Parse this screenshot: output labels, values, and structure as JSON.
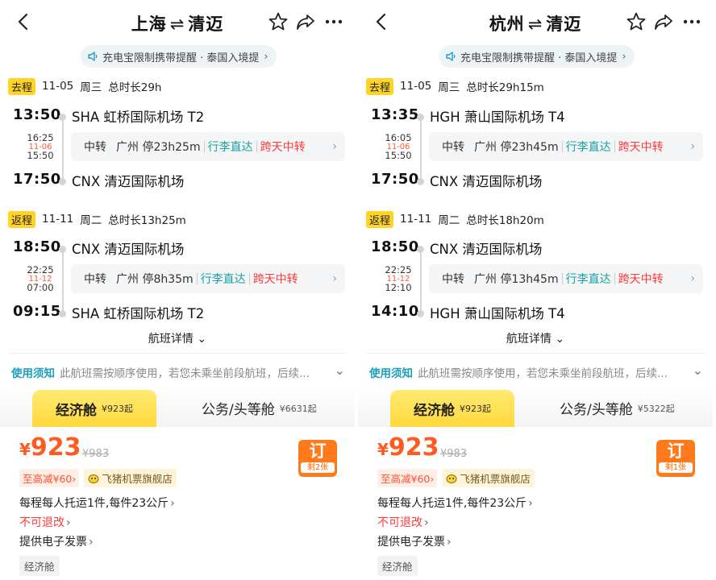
{
  "panels": [
    {
      "title_from": "上海",
      "title_arrow": "⇌",
      "title_to": "清迈",
      "notice": "充电宝限制携带提醒 · 泰国入境提",
      "outbound": {
        "badge": "去程",
        "date": "11-05",
        "weekday": "周三",
        "duration": "总时长29h",
        "dep_time": "13:50",
        "dep_airport": "SHA 虹桥国际机场 T2",
        "stop_arr": "16:25",
        "stop_date": "11-06",
        "stop_dep": "15:50",
        "transfer_label": "中转",
        "transfer_info": "广州 停23h25m",
        "luggage": "行李直达",
        "overday": "跨天中转",
        "arr_time": "17:50",
        "arr_airport": "CNX 清迈国际机场"
      },
      "return": {
        "badge": "返程",
        "date": "11-11",
        "weekday": "周二",
        "duration": "总时长13h25m",
        "dep_time": "18:50",
        "dep_airport": "CNX 清迈国际机场",
        "stop_arr": "22:25",
        "stop_date": "11-12",
        "stop_dep": "07:00",
        "transfer_label": "中转",
        "transfer_info": "广州 停8h35m",
        "luggage": "行李直达",
        "overday": "跨天中转",
        "arr_time": "09:15",
        "arr_airport": "SHA 虹桥国际机场 T2"
      },
      "details_link": "航班详情",
      "rules_label": "使用须知",
      "rules_text": "此航班需按顺序使用，若您未乘坐前段航班，后续...",
      "cabin_active": "经济舱",
      "cabin_active_price": "¥923起",
      "cabin_other": "公务/头等舱",
      "cabin_other_price": "¥6631起",
      "price_symbol": "¥",
      "price": "923",
      "orig_price": "¥983",
      "book_label": "订",
      "remaining": "剩2张",
      "discount": "至高减¥60",
      "shop": "飞猪机票旗舰店",
      "baggage": "每程每人托运1件,每件23公斤",
      "refund": "不可退改",
      "invoice": "提供电子发票",
      "cabin_tag": "经济舱"
    },
    {
      "title_from": "杭州",
      "title_arrow": "⇌",
      "title_to": "清迈",
      "notice": "充电宝限制携带提醒 · 泰国入境提",
      "outbound": {
        "badge": "去程",
        "date": "11-05",
        "weekday": "周三",
        "duration": "总时长29h15m",
        "dep_time": "13:35",
        "dep_airport": "HGH 萧山国际机场 T4",
        "stop_arr": "16:05",
        "stop_date": "11-06",
        "stop_dep": "15:50",
        "transfer_label": "中转",
        "transfer_info": "广州 停23h45m",
        "luggage": "行李直达",
        "overday": "跨天中转",
        "arr_time": "17:50",
        "arr_airport": "CNX 清迈国际机场"
      },
      "return": {
        "badge": "返程",
        "date": "11-11",
        "weekday": "周二",
        "duration": "总时长18h20m",
        "dep_time": "18:50",
        "dep_airport": "CNX 清迈国际机场",
        "stop_arr": "22:25",
        "stop_date": "11-12",
        "stop_dep": "12:10",
        "transfer_label": "中转",
        "transfer_info": "广州 停13h45m",
        "luggage": "行李直达",
        "overday": "跨天中转",
        "arr_time": "14:10",
        "arr_airport": "HGH 萧山国际机场 T4"
      },
      "details_link": "航班详情",
      "rules_label": "使用须知",
      "rules_text": "此航班需按顺序使用，若您未乘坐前段航班，后续...",
      "cabin_active": "经济舱",
      "cabin_active_price": "¥923起",
      "cabin_other": "公务/头等舱",
      "cabin_other_price": "¥5322起",
      "price_symbol": "¥",
      "price": "923",
      "orig_price": "¥983",
      "book_label": "订",
      "remaining": "剩1张",
      "discount": "至高减¥60",
      "shop": "飞猪机票旗舰店",
      "baggage": "每程每人托运1件,每件23公斤",
      "refund": "不可退改",
      "invoice": "提供电子发票",
      "cabin_tag": "经济舱"
    }
  ],
  "icons": [
    "back-arrow-icon",
    "star-icon",
    "share-icon",
    "more-icon",
    "speaker-icon",
    "chevron-right-icon",
    "chevron-down-icon",
    "fliggy-logo-icon"
  ],
  "colors": {
    "accent_yellow": "#ffd426",
    "price_orange": "#ff5a1f",
    "teal": "#1aa0a0",
    "red": "#ff3a3a",
    "book_orange": "#ff7a1a"
  }
}
